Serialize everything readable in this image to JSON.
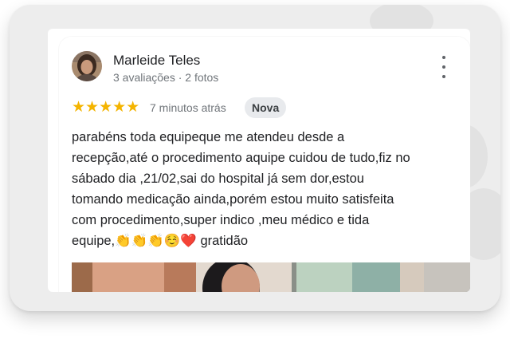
{
  "review": {
    "author_name": "Marleide Teles",
    "author_meta": "3 avaliações · 2 fotos",
    "rating": 5,
    "stars_text": "★★★★★",
    "time_ago": "7 minutos atrás",
    "badge": "Nova",
    "text": "parabéns toda equipeque me atendeu desde a\nrecepção,até o procedimento aquipe cuidou de tudo,fiz no\nsábado dia ,21/02,sai do hospital já sem dor,estou\ntomando medicação ainda,porém estou muito satisfeita\ncom procedimento,super indico ,meu médico e tida\nequipe,👏👏👏☺️❤️ gratidão"
  },
  "colors": {
    "star": "#f4b400",
    "frame": "#ededed",
    "badge_bg": "#e8eaed"
  },
  "icons": {
    "menu": "more-vert-icon",
    "avatar": "user-avatar-photo"
  }
}
